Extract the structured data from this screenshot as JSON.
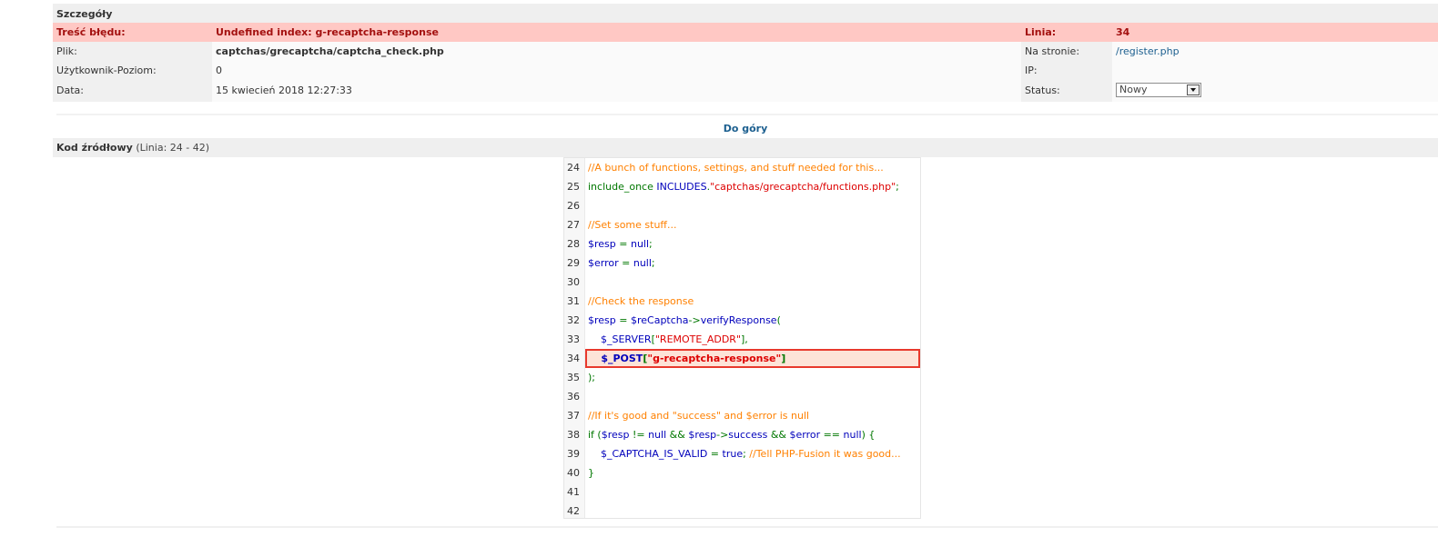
{
  "details": {
    "header": "Szczegóły",
    "error_label": "Treść błędu:",
    "error_value": "Undefined index: g-recaptcha-response",
    "line_label": "Linia:",
    "line_value": "34",
    "file_label": "Plik:",
    "file_value": "captchas/grecaptcha/captcha_check.php",
    "page_label": "Na stronie:",
    "page_value": "/register.php",
    "user_label": "Użytkownik-Poziom:",
    "user_value": "0",
    "ip_label": "IP:",
    "ip_value": "",
    "date_label": "Data:",
    "date_value": "15 kwiecień 2018 12:27:33",
    "status_label": "Status:",
    "status_value": "Nowy"
  },
  "top_link": "Do góry",
  "source": {
    "title": "Kod źródłowy",
    "range": "(Linia: 24 - 42)",
    "highlight_line": 34,
    "lines": [
      {
        "n": "24",
        "parts": [
          {
            "c": "cm",
            "t": "//A bunch of functions, settings, and stuff needed for this..."
          }
        ]
      },
      {
        "n": "25",
        "parts": [
          {
            "c": "kw",
            "t": "include_once "
          },
          {
            "c": "df",
            "t": "INCLUDES"
          },
          {
            "c": "kw",
            "t": "."
          },
          {
            "c": "st",
            "t": "\"captchas/grecaptcha/functions.php\""
          },
          {
            "c": "kw",
            "t": ";"
          }
        ]
      },
      {
        "n": "26",
        "parts": []
      },
      {
        "n": "27",
        "parts": [
          {
            "c": "cm",
            "t": "//Set some stuff..."
          }
        ]
      },
      {
        "n": "28",
        "parts": [
          {
            "c": "df",
            "t": "$resp "
          },
          {
            "c": "kw",
            "t": "= "
          },
          {
            "c": "df",
            "t": "null"
          },
          {
            "c": "kw",
            "t": ";"
          }
        ]
      },
      {
        "n": "29",
        "parts": [
          {
            "c": "df",
            "t": "$error "
          },
          {
            "c": "kw",
            "t": "= "
          },
          {
            "c": "df",
            "t": "null"
          },
          {
            "c": "kw",
            "t": ";"
          }
        ]
      },
      {
        "n": "30",
        "parts": []
      },
      {
        "n": "31",
        "parts": [
          {
            "c": "cm",
            "t": "//Check the response"
          }
        ]
      },
      {
        "n": "32",
        "parts": [
          {
            "c": "df",
            "t": "$resp "
          },
          {
            "c": "kw",
            "t": "= "
          },
          {
            "c": "df",
            "t": "$reCaptcha"
          },
          {
            "c": "kw",
            "t": "->"
          },
          {
            "c": "df",
            "t": "verifyResponse"
          },
          {
            "c": "kw",
            "t": "("
          }
        ]
      },
      {
        "n": "33",
        "parts": [
          {
            "c": "df",
            "t": "    $_SERVER"
          },
          {
            "c": "kw",
            "t": "["
          },
          {
            "c": "st",
            "t": "\"REMOTE_ADDR\""
          },
          {
            "c": "kw",
            "t": "],"
          }
        ]
      },
      {
        "n": "34",
        "parts": [
          {
            "c": "df",
            "t": "    $_POST"
          },
          {
            "c": "kw",
            "t": "["
          },
          {
            "c": "st",
            "t": "\"g-recaptcha-response\""
          },
          {
            "c": "kw",
            "t": "]"
          }
        ]
      },
      {
        "n": "35",
        "parts": [
          {
            "c": "kw",
            "t": ");"
          }
        ]
      },
      {
        "n": "36",
        "parts": []
      },
      {
        "n": "37",
        "parts": [
          {
            "c": "cm",
            "t": "//If it's good and \"success\" and $error is null"
          }
        ]
      },
      {
        "n": "38",
        "parts": [
          {
            "c": "kw",
            "t": "if ("
          },
          {
            "c": "df",
            "t": "$resp "
          },
          {
            "c": "kw",
            "t": "!= "
          },
          {
            "c": "df",
            "t": "null "
          },
          {
            "c": "kw",
            "t": "&& "
          },
          {
            "c": "df",
            "t": "$resp"
          },
          {
            "c": "kw",
            "t": "->"
          },
          {
            "c": "df",
            "t": "success "
          },
          {
            "c": "kw",
            "t": "&& "
          },
          {
            "c": "df",
            "t": "$error "
          },
          {
            "c": "kw",
            "t": "== "
          },
          {
            "c": "df",
            "t": "null"
          },
          {
            "c": "kw",
            "t": ") {"
          }
        ]
      },
      {
        "n": "39",
        "parts": [
          {
            "c": "df",
            "t": "    $_CAPTCHA_IS_VALID "
          },
          {
            "c": "kw",
            "t": "= "
          },
          {
            "c": "df",
            "t": "true"
          },
          {
            "c": "kw",
            "t": "; "
          },
          {
            "c": "cm",
            "t": "//Tell PHP-Fusion it was good..."
          }
        ]
      },
      {
        "n": "40",
        "parts": [
          {
            "c": "kw",
            "t": "}"
          }
        ]
      },
      {
        "n": "41",
        "parts": []
      },
      {
        "n": "42",
        "parts": []
      }
    ]
  }
}
